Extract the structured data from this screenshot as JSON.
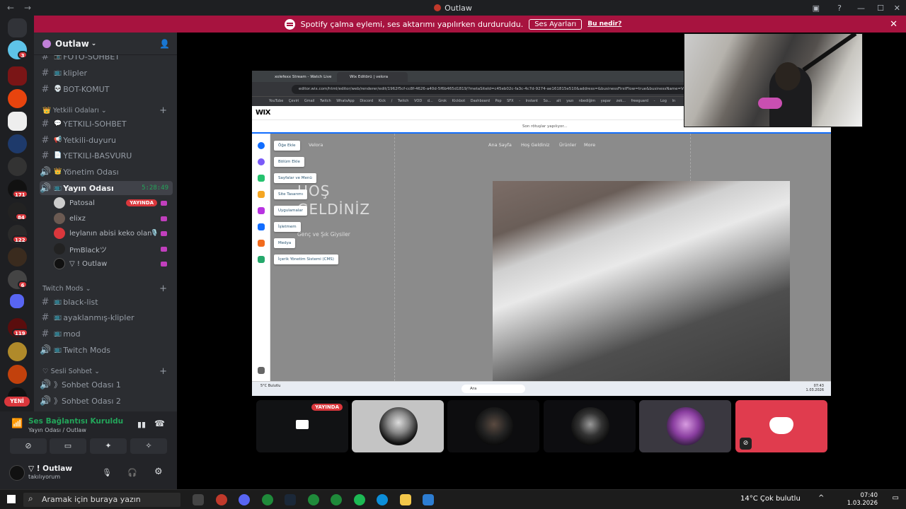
{
  "window": {
    "title": "Outlaw"
  },
  "notice": {
    "text": "Spotify çalma eylemi, ses aktarımı yapılırken durduruldu.",
    "button": "Ses Ayarları",
    "link": "Bu nedir?"
  },
  "server": {
    "name": "Outlaw"
  },
  "channels": [
    {
      "name": "FOTO-SOHBET",
      "type": "text"
    },
    {
      "name": "klipler",
      "type": "text"
    },
    {
      "name": "BOT-KOMUT",
      "type": "text"
    }
  ],
  "cat_yetkili": {
    "label": "Yetkili Odaları"
  },
  "yetkili_channels": [
    {
      "name": "YETKILI-SOHBET",
      "type": "text"
    },
    {
      "name": "Yetkili-duyuru",
      "type": "text"
    },
    {
      "name": "YETKILI-BASVURU",
      "type": "text"
    },
    {
      "name": "Yönetim Odası",
      "type": "voice"
    }
  ],
  "active_voice": {
    "name": "Yayın Odası",
    "timer": "5:28:49"
  },
  "voice_users": [
    {
      "name": "Patosal",
      "live": "YAYINDA"
    },
    {
      "name": "elixz"
    },
    {
      "name": "leylanın abisi keko olan"
    },
    {
      "name": "PmBlackツ"
    },
    {
      "name": "▽ ! Outlaw"
    }
  ],
  "cat_twitch": {
    "label": "Twitch Mods"
  },
  "twitch_channels": [
    {
      "name": "black-list",
      "type": "text"
    },
    {
      "name": "ayaklanmış-klipler",
      "type": "text"
    },
    {
      "name": "mod",
      "type": "text"
    },
    {
      "name": "Twitch Mods",
      "type": "voice"
    }
  ],
  "cat_sesli": {
    "label": "Sesli Sohbet"
  },
  "sesli_channels": [
    {
      "name": "》Sohbet Odası 1",
      "type": "voice"
    },
    {
      "name": "》Sohbet Odası 2",
      "type": "voice"
    }
  ],
  "server_badges": [
    "3",
    "171",
    "84",
    "122",
    "6",
    "119"
  ],
  "new_badge": "YENİ",
  "voice_panel": {
    "status": "Ses Bağlantısı Kuruldu",
    "sub": "Yayın Odası / Outlaw",
    "user": "▽ ! Outlaw",
    "user_status": "takılıyorum"
  },
  "browser": {
    "tabs": [
      "xolefexx Stream - Watch Live o...",
      "Wix Editörü | velora"
    ],
    "url": "editor.wix.com/html/editor/web/renderer/edit/1962f5cf-cc8f-4626-a40d-5f6b465d1819/?metaSiteId=c45eb02c-fa3c-4c7d-9274-ae161815e510&address=&businessFirstFlow=true&businessName=Velora&b",
    "bookmarks": "YouTube Çeviri Gmail Twitch WhatsApp Discord Kick / Twitch VOD d... Grok Kickbot Dashboard Pop SFX - Instant So... alt yazı nbediğim yapar zek... freeguard - Log In",
    "wix_logo": "WIX",
    "saving": "Son rötuşlar yapılıyor...",
    "menu": [
      "Öğe Ekle",
      "Bölüm Ekle",
      "Sayfalar ve Menü",
      "Site Tasarımı",
      "Uygulamalar",
      "İşletmem",
      "Medya",
      "İçerik Yönetim Sistemi (CMS)"
    ],
    "site_brand": "Velora",
    "site_nav": [
      "Ana Sayfa",
      "Hoş Geldiniz",
      "Ürünler",
      "More"
    ],
    "hero": "HOŞ GELDİNİZ",
    "hero_sub": "Genç ve Şık Giysiler",
    "task_search": "Ara",
    "task_weather": "5°C Bulutlu",
    "task_time": "07:43",
    "task_date": "1.03.2026"
  },
  "tiles": [
    {
      "live": "YAYINDA"
    }
  ],
  "taskbar": {
    "search": "Aramak için buraya yazın",
    "weather": "14°C  Çok bulutlu",
    "time": "07:40",
    "date": "1.03.2026"
  }
}
